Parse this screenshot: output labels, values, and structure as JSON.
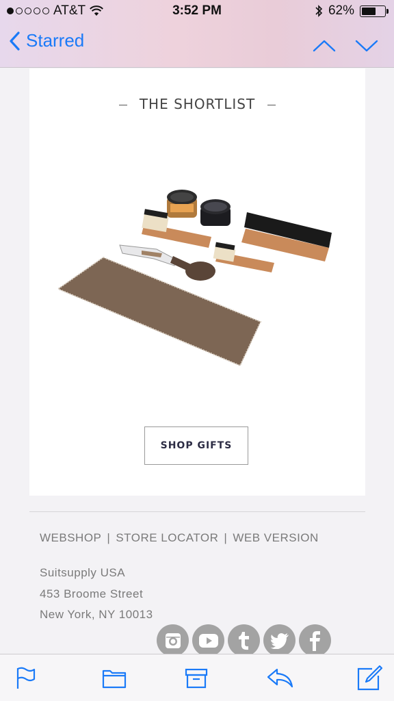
{
  "status_bar": {
    "carrier": "AT&T",
    "time": "3:52 PM",
    "battery": "62%",
    "battery_level": 0.62,
    "signal_bars": 1,
    "icons": [
      "wifi-icon",
      "bluetooth-icon",
      "battery-icon"
    ]
  },
  "nav": {
    "back_label": "Starred",
    "icons": [
      "back-chevron-icon",
      "chevron-up-icon",
      "chevron-down-icon"
    ]
  },
  "email": {
    "section_title": "THE SHORTLIST",
    "product_image": "shoe care kit with brushes, polish jars, shoe horn and cloth",
    "button_label": "SHOP GIFTS",
    "footer_links": [
      "WEBSHOP",
      "STORE LOCATOR",
      "WEB VERSION"
    ],
    "separator": "|",
    "address": {
      "company": "Suitsupply USA",
      "street": "453 Broome Street",
      "city": "New York, NY 10013"
    },
    "social_icons": [
      "instagram-icon",
      "youtube-icon",
      "tumblr-icon",
      "twitter-icon",
      "facebook-icon"
    ]
  },
  "toolbar": {
    "icons": [
      "flag-icon",
      "folder-icon",
      "archive-icon",
      "reply-icon",
      "compose-icon"
    ]
  },
  "colors": {
    "accent": "#1a7af8",
    "footer_text": "#7a7a7a",
    "social_bg": "#a3a3a3"
  }
}
